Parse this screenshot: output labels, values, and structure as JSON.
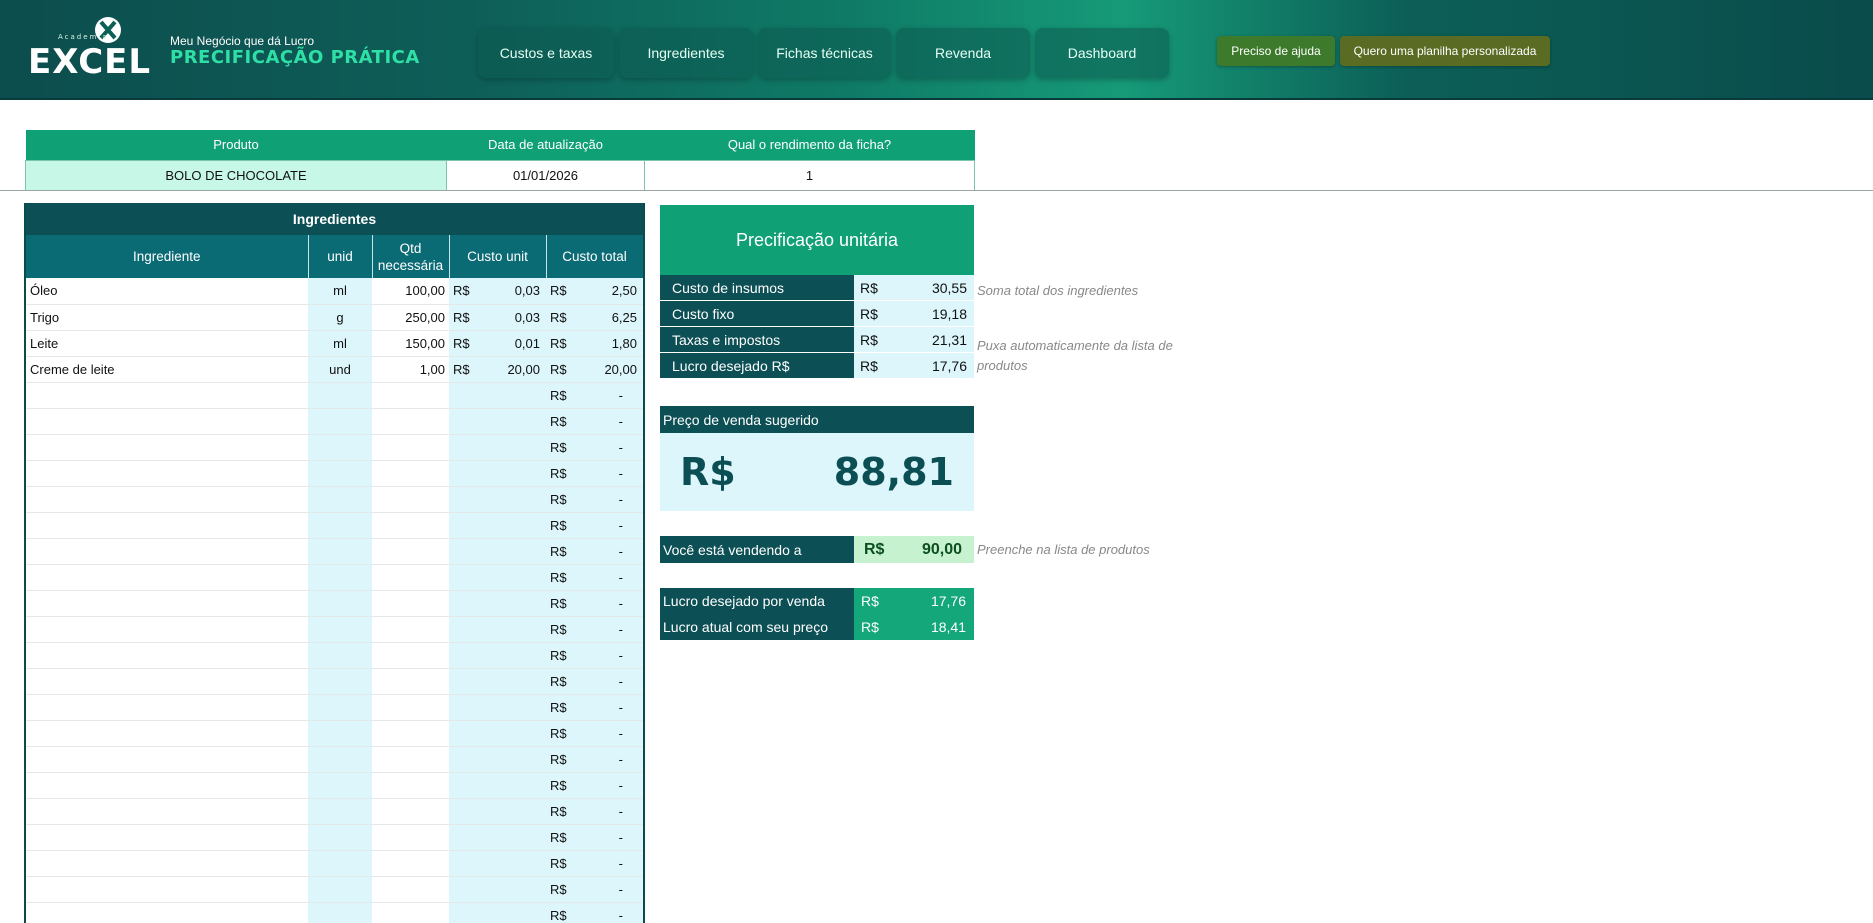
{
  "header": {
    "logo_small": "Academia",
    "logo_main": "EXCEL",
    "subtitle": "Meu Negócio que dá Lucro",
    "title": "PRECIFICAÇÃO PRÁTICA",
    "nav": [
      "Custos e taxas",
      "Ingredientes",
      "Fichas técnicas",
      "Revenda",
      "Dashboard"
    ],
    "help_label": "Preciso de ajuda",
    "custom_label": "Quero uma planilha personalizada"
  },
  "product": {
    "headers": [
      "Produto",
      "Data de atualização",
      "Qual o rendimento da ficha?"
    ],
    "name": "BOLO DE CHOCOLATE",
    "date": "01/01/2026",
    "yield": "1"
  },
  "ingredients": {
    "title": "Ingredientes",
    "headers": [
      "Ingrediente",
      "unid",
      "Qtd necessária",
      "Custo unit",
      "Custo total"
    ],
    "currency": "R$",
    "rows": [
      {
        "name": "Óleo",
        "unit": "ml",
        "qty": "100,00",
        "unit_cost": "0,03",
        "total": "2,50"
      },
      {
        "name": "Trigo",
        "unit": "g",
        "qty": "250,00",
        "unit_cost": "0,03",
        "total": "6,25"
      },
      {
        "name": "Leite",
        "unit": "ml",
        "qty": "150,00",
        "unit_cost": "0,01",
        "total": "1,80"
      },
      {
        "name": "Creme de leite",
        "unit": "und",
        "qty": "1,00",
        "unit_cost": "20,00",
        "total": "20,00"
      }
    ],
    "empty_total": "-"
  },
  "pricing": {
    "title": "Precificação unitária",
    "currency": "R$",
    "rows": [
      {
        "label": "Custo de insumos",
        "value": "30,55"
      },
      {
        "label": "Custo fixo",
        "value": "19,18"
      },
      {
        "label": "Taxas e impostos",
        "value": "21,31"
      },
      {
        "label": "Lucro desejado R$",
        "value": "17,76"
      }
    ],
    "note_total": "Soma total dos ingredientes",
    "note_auto": "Puxa automaticamente da lista de produtos",
    "suggested_label": "Preço de venda sugerido",
    "suggested_price": "88,81",
    "selling_label": "Você está vendendo a",
    "selling_price": "90,00",
    "selling_note": "Preenche na lista de produtos",
    "profit_rows": [
      {
        "label": "Lucro desejado por venda",
        "value": "17,76"
      },
      {
        "label": "Lucro atual com seu preço",
        "value": "18,41"
      }
    ]
  }
}
